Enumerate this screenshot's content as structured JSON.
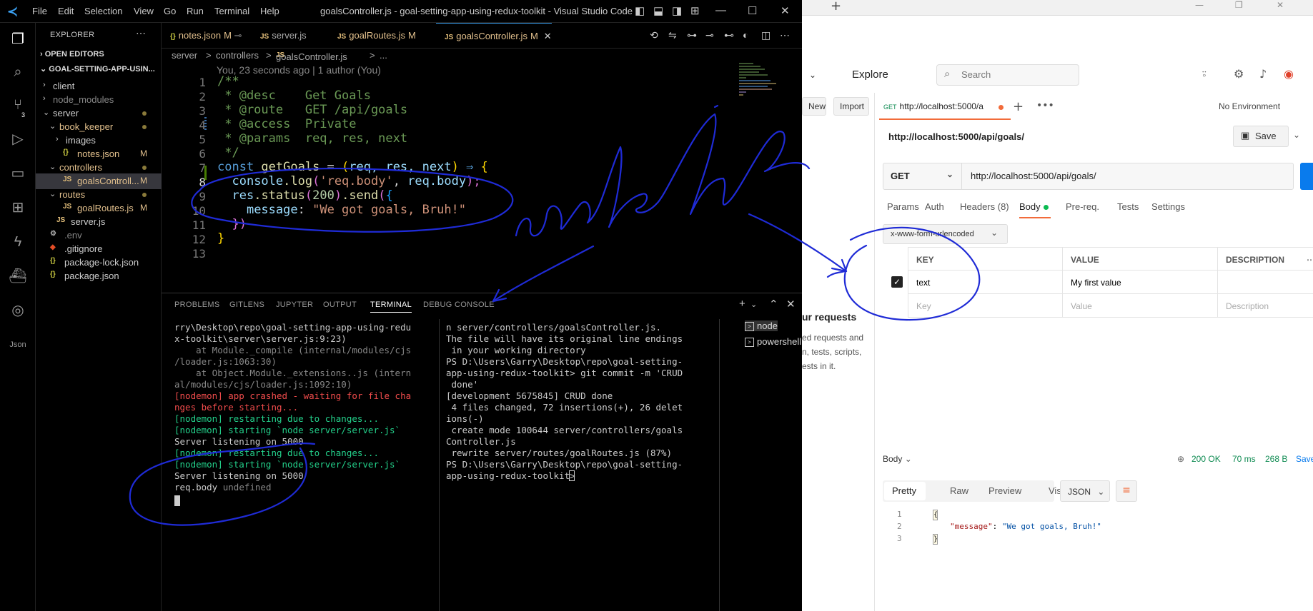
{
  "vscode": {
    "window_title": "goalsController.js - goal-setting-app-using-redux-toolkit - Visual Studio Code",
    "menu": [
      "File",
      "Edit",
      "Selection",
      "View",
      "Go",
      "Run",
      "Terminal",
      "Help"
    ],
    "explorer": {
      "title": "EXPLORER",
      "open_editors": "OPEN EDITORS",
      "workspace": "GOAL-SETTING-APP-USIN...",
      "items": [
        {
          "label": "client",
          "kind": "folder",
          "open": false,
          "depth": 0
        },
        {
          "label": "node_modules",
          "kind": "folder",
          "open": false,
          "depth": 0,
          "dim": true
        },
        {
          "label": "server",
          "kind": "folder",
          "open": true,
          "depth": 0,
          "dot": true
        },
        {
          "label": "book_keeper",
          "kind": "folder",
          "open": true,
          "depth": 1,
          "modified": true,
          "dot": true
        },
        {
          "label": "images",
          "kind": "folder",
          "open": false,
          "depth": 2
        },
        {
          "label": "notes.json",
          "kind": "json",
          "depth": 2,
          "modified": true,
          "mark": "M"
        },
        {
          "label": "controllers",
          "kind": "folder",
          "open": true,
          "depth": 1,
          "modified": true,
          "dot": true
        },
        {
          "label": "goalsControll...",
          "kind": "js",
          "depth": 2,
          "modified": true,
          "mark": "M",
          "selected": true
        },
        {
          "label": "routes",
          "kind": "folder",
          "open": true,
          "depth": 1,
          "modified": true,
          "dot": true
        },
        {
          "label": "goalRoutes.js",
          "kind": "js",
          "depth": 2,
          "modified": true,
          "mark": "M"
        },
        {
          "label": "server.js",
          "kind": "js",
          "depth": 1
        },
        {
          "label": ".env",
          "kind": "env",
          "depth": 0,
          "dim": true
        },
        {
          "label": ".gitignore",
          "kind": "git",
          "depth": 0
        },
        {
          "label": "package-lock.json",
          "kind": "json",
          "depth": 0
        },
        {
          "label": "package.json",
          "kind": "json",
          "depth": 0
        }
      ]
    },
    "tabs": [
      {
        "label": "notes.json",
        "mark": "M",
        "icon": "{}"
      },
      {
        "label": "server.js",
        "mark": "",
        "icon": "JS"
      },
      {
        "label": "goalRoutes.js",
        "mark": "M",
        "icon": "JS"
      },
      {
        "label": "goalsController.js",
        "mark": "M",
        "icon": "JS",
        "active": true
      }
    ],
    "breadcrumb": [
      "server",
      ">",
      "controllers",
      ">",
      "goalsController.js",
      ">",
      "..."
    ],
    "blame": "You, 23 seconds ago | 1 author (You)",
    "code": {
      "line_numbers": [
        "1",
        "2",
        "3",
        "4",
        "5",
        "6",
        "7",
        "8",
        "9",
        "10",
        "11",
        "12",
        "13"
      ],
      "l1": "/**",
      "l2a": " * @desc",
      "l2b": "    Get Goals",
      "l3a": " * @route",
      "l3b": "   GET /api/goals",
      "l4a": " * @access",
      "l4b": "  Private",
      "l5a": " * @params",
      "l5b": "  req, res, next",
      "l6": " */",
      "l7_const": "const ",
      "l7_name": "getGoals",
      "l7_eq": " = ",
      "l7_open": "(",
      "l7_args": "req, res, next",
      "l7_close": ")",
      "l7_arrow": " ⇒ ",
      "l7_brace": "{",
      "l8_indent": "  ",
      "l8_obj": "console",
      "l8_fn": ".log",
      "l8_open": "(",
      "l8_str": "'req.body'",
      "l8_mid": ", ",
      "l8_var": "req",
      "l8_prop": ".body",
      "l8_close": ");",
      "l9_indent": "  ",
      "l9_obj": "res",
      "l9_fn": ".status",
      "l9_open": "(",
      "l9_num": "200",
      "l9_close": ")",
      "l9_send": ".send",
      "l9_open2": "(",
      "l9_brace": "{",
      "l10_indent": "    ",
      "l10_key": "message",
      "l10_colon": ": ",
      "l10_str": "\"We got goals, Bruh!\"",
      "l11_indent": "  ",
      "l11_close": "})",
      "l12": "}"
    },
    "panel": {
      "tabs": [
        "PROBLEMS",
        "GITLENS",
        "JUPYTER",
        "OUTPUT",
        "TERMINAL",
        "DEBUG CONSOLE"
      ],
      "active_tab": "TERMINAL",
      "terminal_left": [
        {
          "t": "rry\\Desktop\\repo\\goal-setting-app-using-redu",
          "c": "norm"
        },
        {
          "t": "x-toolkit\\server\\server.js:9:23)",
          "c": "norm"
        },
        {
          "t": "    at Module._compile (internal/modules/cjs",
          "c": "dim"
        },
        {
          "t": "/loader.js:1063:30)",
          "c": "dim"
        },
        {
          "t": "    at Object.Module._extensions..js (intern",
          "c": "dim"
        },
        {
          "t": "al/modules/cjs/loader.js:1092:10)",
          "c": "dim"
        },
        {
          "t": "[nodemon] app crashed - waiting for file cha",
          "c": "red"
        },
        {
          "t": "nges before starting...",
          "c": "red"
        },
        {
          "t": "[nodemon] restarting due to changes...",
          "c": "green"
        },
        {
          "t": "[nodemon] starting `node server/server.js`",
          "c": "green"
        },
        {
          "t": "Server listening on 5000",
          "c": "norm"
        },
        {
          "t": "[nodemon] restarting due to changes...",
          "c": "green"
        },
        {
          "t": "[nodemon] starting `node server/server.js`",
          "c": "green"
        },
        {
          "t": "Server listening on 5000",
          "c": "norm"
        }
      ],
      "reqbody_label": "req.body",
      "reqbody_value": " undefined",
      "terminal_right": [
        "n server/controllers/goalsController.js.",
        "The file will have its original line endings",
        " in your working directory",
        "PS D:\\Users\\Garry\\Desktop\\repo\\goal-setting-",
        "app-using-redux-toolkit> git commit -m 'CRUD",
        " done'",
        "[development 5675845] CRUD done",
        " 4 files changed, 72 insertions(+), 26 delet",
        "ions(-)",
        " create mode 100644 server/controllers/goals",
        "Controller.js",
        " rewrite server/routes/goalRoutes.js (87%)",
        "PS D:\\Users\\Garry\\Desktop\\repo\\goal-setting-",
        "app-using-redux-toolkit> "
      ],
      "terminals": [
        "node",
        "powershell"
      ]
    }
  },
  "postman": {
    "explore": "Explore",
    "search_placeholder": "Search",
    "left": {
      "new": "New",
      "import": "Import",
      "heading": "ur requests",
      "lines": [
        "ed requests and",
        "n, tests, scripts,",
        "ests in it."
      ]
    },
    "tab": {
      "method": "GET",
      "label": "http://localhost:5000/a"
    },
    "environment": "No Environment",
    "url_title": "http://localhost:5000/api/goals/",
    "save": "Save",
    "method": "GET",
    "url": "http://localhost:5000/api/goals/",
    "subtabs": [
      "Params",
      "Auth",
      "Headers (8)",
      "Body",
      "Pre-req.",
      "Tests",
      "Settings"
    ],
    "active_subtab": "Body",
    "encoding": "x-www-form-urlencoded",
    "table": {
      "headers": [
        "KEY",
        "VALUE",
        "DESCRIPTION"
      ],
      "rows": [
        {
          "key": "text",
          "value": "My first value",
          "description": "",
          "checked": true
        }
      ],
      "placeholder": {
        "key": "Key",
        "value": "Value",
        "description": "Description"
      }
    },
    "response": {
      "label": "Body",
      "status": "200 OK",
      "time": "70 ms",
      "size": "268 B",
      "save": "Save",
      "views": [
        "Pretty",
        "Raw",
        "Preview",
        "Visualize"
      ],
      "format": "JSON",
      "lines": [
        "1",
        "2",
        "3"
      ],
      "key": "\"message\"",
      "colon": ": ",
      "value": "\"We got goals, Bruh!\""
    }
  },
  "annotation": {
    "color": "#1f2bd6"
  }
}
